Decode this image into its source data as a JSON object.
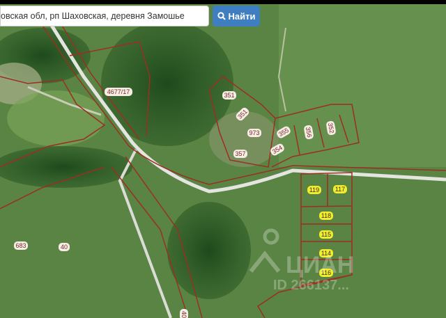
{
  "search": {
    "value": "овская обл, рп Шаховская, деревня Замошье",
    "button_label": "Найти",
    "button_icon": "search-icon",
    "button_color": "#3f7ec0"
  },
  "map": {
    "parcel_color": "#9b2f22",
    "parcel_labels": [
      "4677/17",
      "351",
      "351",
      "973",
      "357",
      "355",
      "354",
      "356",
      "352",
      "683",
      "40",
      "40"
    ],
    "highlighted_labels": [
      "119",
      "117",
      "118",
      "115",
      "114",
      "116"
    ],
    "highlight_color": "#f2ec2a"
  },
  "watermark": {
    "brand": "ЦИАН",
    "id": "ID 266137..."
  }
}
